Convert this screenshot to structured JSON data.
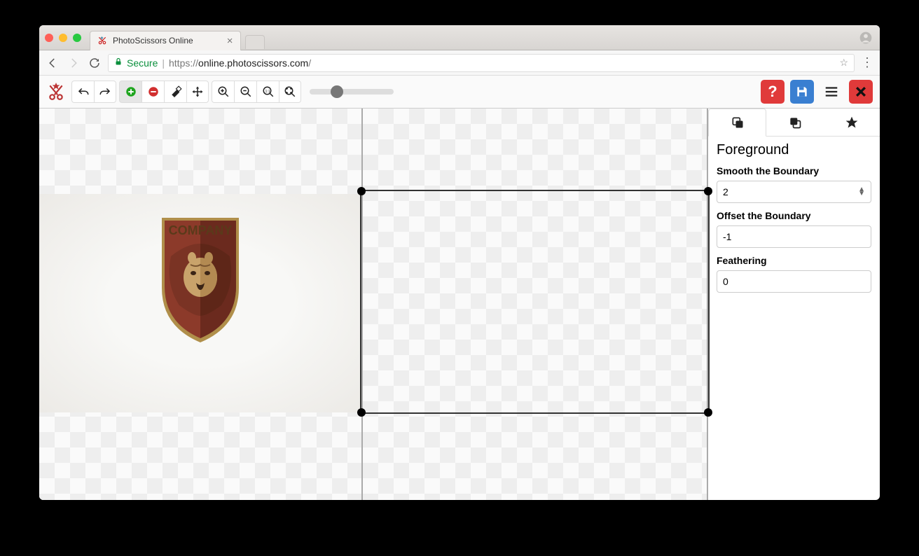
{
  "browser": {
    "tab_title": "PhotoScissors Online",
    "secure_label": "Secure",
    "url_proto": "https://",
    "url_host": "online.photoscissors.com",
    "url_path": "/"
  },
  "toolbar": {
    "slider_value": 25
  },
  "logo_text": "COMPANY",
  "sidebar": {
    "heading": "Foreground",
    "smooth_label": "Smooth the Boundary",
    "smooth_value": "2",
    "offset_label": "Offset the Boundary",
    "offset_value": "-1",
    "feather_label": "Feathering",
    "feather_value": "0"
  }
}
